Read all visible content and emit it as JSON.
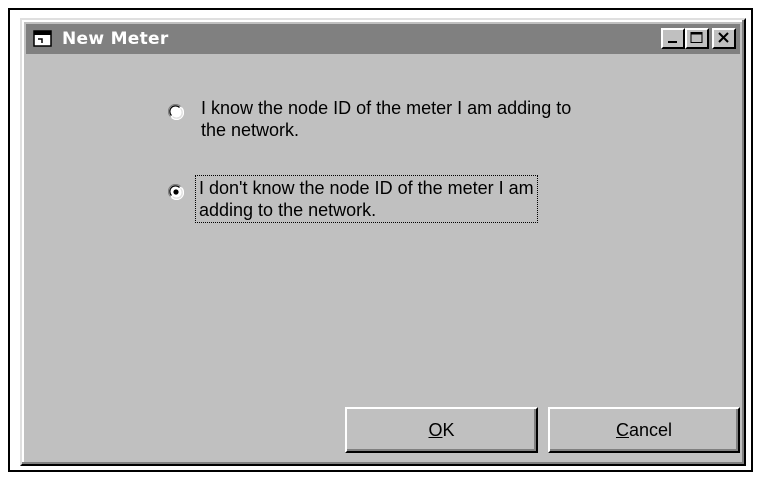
{
  "window": {
    "title": "New Meter",
    "icon": "app-window-icon"
  },
  "title_buttons": {
    "minimize_icon": "minimize-icon",
    "maximize_icon": "maximize-icon",
    "close_icon": "close-icon"
  },
  "options": [
    {
      "line1": "I know the node ID of the meter I am adding to",
      "line2": "the network.",
      "selected": false
    },
    {
      "line1": "I don't know the node ID of the meter I am",
      "line2": "adding to the network.",
      "selected": true
    }
  ],
  "buttons": {
    "ok": {
      "accel": "O",
      "rest": "K"
    },
    "cancel": {
      "accel": "C",
      "rest": "ancel"
    }
  }
}
